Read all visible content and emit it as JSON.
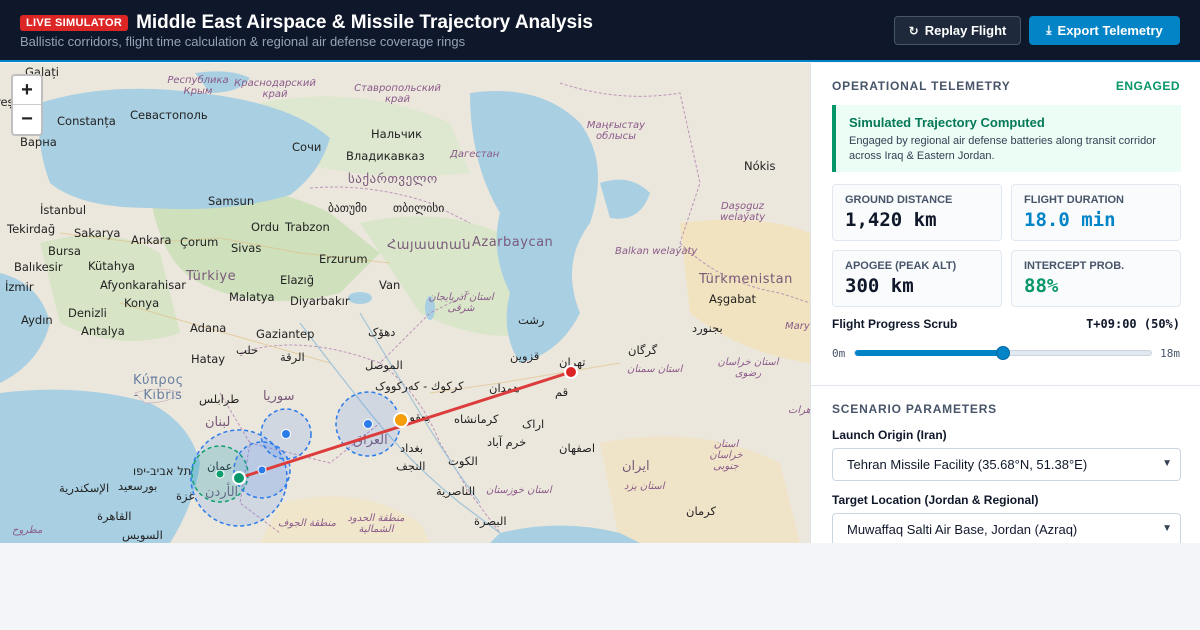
{
  "header": {
    "badge": "LIVE SIMULATOR",
    "title": "Middle East Airspace & Missile Trajectory Analysis",
    "subtitle": "Ballistic corridors, flight time calculation & regional air defense coverage rings",
    "replay_label": "Replay Flight",
    "export_label": "Export Telemetry"
  },
  "map": {
    "zoom_in": "+",
    "zoom_out": "−",
    "labels": {
      "galati": "Galați",
      "res": "reș",
      "krym": "Республика Крым",
      "krasnodar": "Краснодарский край",
      "stavropol": "Ставропольский край",
      "constanta": "Constanța",
      "sevastopol": "Севастополь",
      "varna": "Варна",
      "nalchik": "Нальчик",
      "sochi": "Сочи",
      "vladikavkaz": "Владикавказ",
      "dagestan": "Дагестан",
      "mangystau": "Маңғыстау облысы",
      "nokis": "Nókis",
      "georgia": "საქართველო",
      "samsun": "Samsun",
      "batumi": "ბათუმი",
      "tbilisi": "თბილისი",
      "istanbul": "İstanbul",
      "tekirdag": "Tekirdağ",
      "sakarya": "Sakarya",
      "ankara": "Ankara",
      "corum": "Çorum",
      "ordu": "Ordu",
      "trabzon": "Trabzon",
      "armenia": "Հայաստան",
      "azerbaycan": "Azarbaycan",
      "dasoguz": "Daşoguz welaýaty",
      "bursa": "Bursa",
      "sivas": "Sivas",
      "erzurum": "Erzurum",
      "balkan": "Balkan welaýaty",
      "balikesir": "Balıkesir",
      "kutahya": "Kütahya",
      "turkiye": "Türkiye",
      "elazig": "Elazığ",
      "turkmenistan": "Türkmenistan",
      "izmir": "İzmir",
      "afyon": "Afyonkarahisar",
      "van": "Van",
      "ashgabat": "Aşgabat",
      "malatya": "Malatya",
      "diyarbakir": "Diyarbakır",
      "azarbayjan": "استان آذربایجان شرقی",
      "konya": "Konya",
      "aydin": "Aydın",
      "denizli": "Denizli",
      "antalya": "Antalya",
      "adana": "Adana",
      "gaziantep": "Gaziantep",
      "duhok": "دهۆک",
      "rasht": "رشت",
      "bojnurd": "بجنورد",
      "mary": "Mary",
      "hatay": "Hatay",
      "aleppo": "حلب",
      "raqqa": "الرقة",
      "mosul": "الموصل",
      "qazvin": "قزوین",
      "gorgan": "گرگان",
      "tehran": "تهران",
      "kibris": "Κύπρος - Kıbrıs",
      "syria": "سوريا",
      "kirkuk": "كركوك - کەرکووک",
      "hamadan": "همدان",
      "qom": "قم",
      "semnan": "استان سمنان",
      "khorasan_razavi": "استان خراسان رضوی",
      "tripoli": "طرابلس",
      "lebanon": "لبنان",
      "baqubah": "بعقوبة",
      "kermanshah": "كرمانشاه",
      "arak": "اراک",
      "herat": "هرات",
      "iraq": "العراق",
      "baghdad": "بغداد",
      "khorramabad": "خرم آباد",
      "isfahan": "اصفهان",
      "khorasan_jonubi": "استان خراسان جنوبی",
      "telaviv": "תל אביב-יפו",
      "amman": "عمان",
      "najaf": "النجف",
      "kut": "الكوت",
      "iran": "ایران",
      "jordan": "الأردن",
      "alexandria": "الإسكندرية",
      "portsaid": "بورسعيد",
      "gaza": "غزة",
      "nasiriyah": "الناصرية",
      "khuzestan": "استان خوزستان",
      "yazd": "استان یزد",
      "cairo": "القاهرة",
      "jouf": "منطقة الجوف",
      "northern_border": "منطقة الحدود الشمالية",
      "basra": "البصرة",
      "kerman": "کرمان",
      "suez": "السويس",
      "matruh": "مطروح"
    }
  },
  "telemetry": {
    "heading": "OPERATIONAL TELEMETRY",
    "status": "ENGAGED",
    "alert_title": "Simulated Trajectory Computed",
    "alert_body": "Engaged by regional air defense batteries along transit corridor across Iraq & Eastern Jordan.",
    "cards": [
      {
        "label": "GROUND DISTANCE",
        "value": "1,420 km",
        "color": "#0f172a"
      },
      {
        "label": "FLIGHT DURATION",
        "value": "18.0 min",
        "color": "#0284c7"
      },
      {
        "label": "APOGEE (PEAK ALT)",
        "value": "300 km",
        "color": "#0f172a"
      },
      {
        "label": "INTERCEPT PROB.",
        "value": "88%",
        "color": "#059669"
      }
    ],
    "scrub_label": "Flight Progress Scrub",
    "scrub_time": "T+09:00 (50%)",
    "scrub_min": "0m",
    "scrub_max": "18m",
    "progress": 0.5
  },
  "scenario": {
    "heading": "SCENARIO PARAMETERS",
    "origin_label": "Launch Origin (Iran)",
    "origin_value": "Tehran Missile Facility (35.68°N, 51.38°E)",
    "target_label": "Target Location (Jordan & Regional)",
    "target_value": "Muwaffaq Salti Air Base, Jordan (Azraq)"
  },
  "colors": {
    "header_bg": "#0f172a",
    "accent": "#0284c7",
    "danger": "#dc2626",
    "success": "#059669",
    "trajectory": "#dc3c3c"
  }
}
